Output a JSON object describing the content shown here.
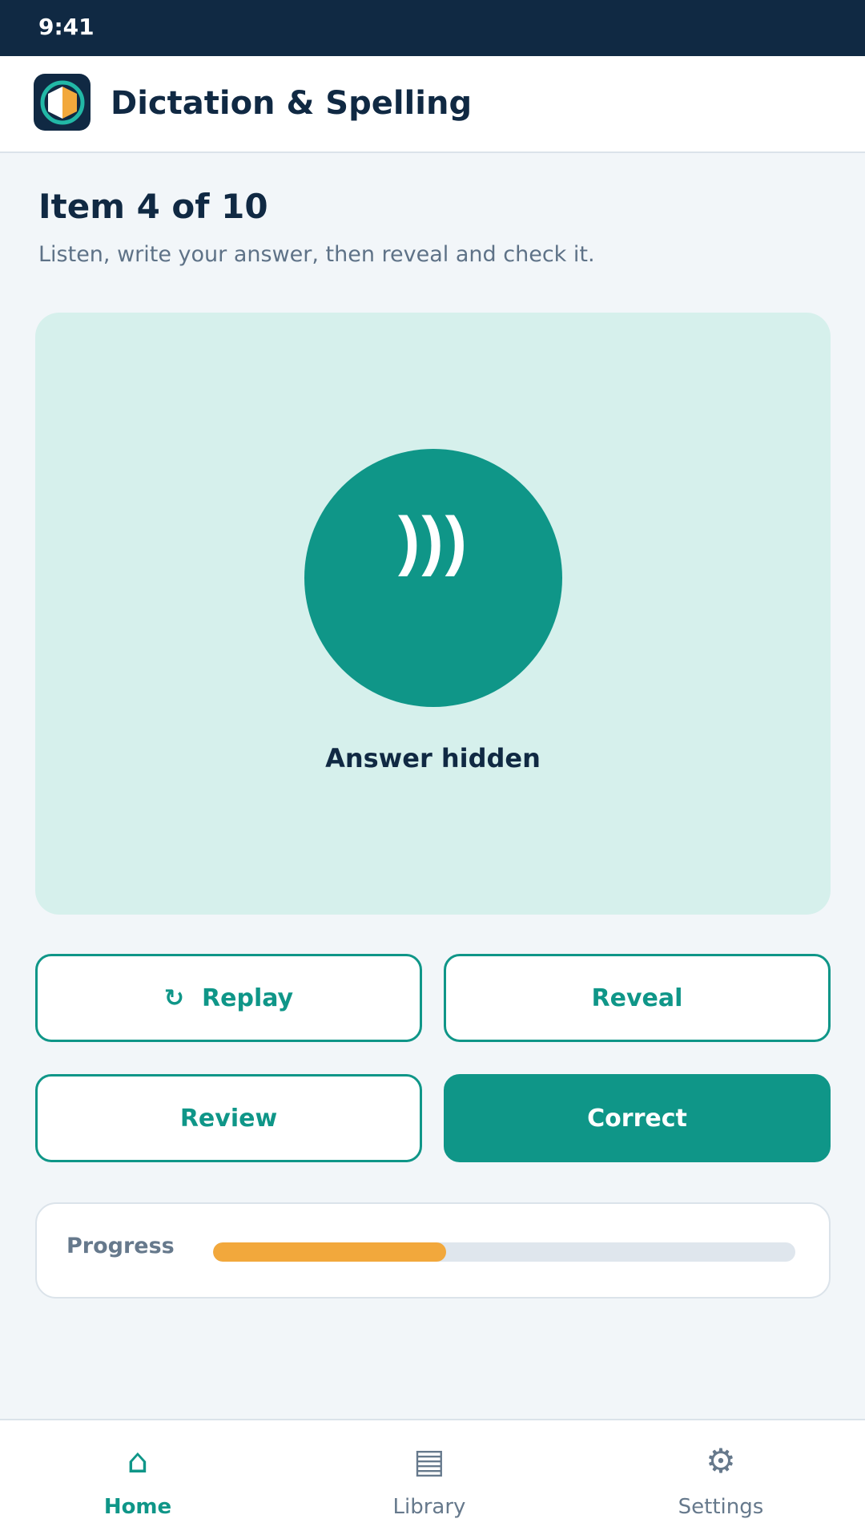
{
  "status_bar": {
    "time": "9:41"
  },
  "header": {
    "title": "Dictation & Spelling"
  },
  "heading": {
    "title": "Item 4 of 10",
    "subtitle": "Listen, write your answer, then reveal and check it."
  },
  "audio_card": {
    "play_icon_glyph": ")))",
    "play_icon_name": "speaker-waves-icon",
    "answer_status": "Answer hidden"
  },
  "actions": {
    "replay_icon": "↻",
    "replay_label": "Replay",
    "reveal_label": "Reveal",
    "review_label": "Review",
    "correct_label": "Correct"
  },
  "progress": {
    "label": "Progress",
    "fraction": 0.4
  },
  "nav": {
    "items": [
      {
        "label": "Home",
        "icon": "⌂",
        "icon_name": "home-icon",
        "active": true
      },
      {
        "label": "Library",
        "icon": "▤",
        "icon_name": "library-icon",
        "active": false
      },
      {
        "label": "Settings",
        "icon": "⚙",
        "icon_name": "gear-icon",
        "active": false
      }
    ]
  },
  "colors": {
    "primary": "#0f9688",
    "navy": "#102943",
    "card_bg": "#d6f0ec",
    "accent": "#f2a83c"
  }
}
